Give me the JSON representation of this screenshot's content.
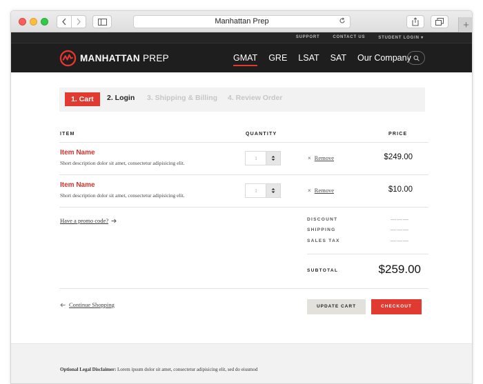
{
  "browser": {
    "url_title": "Manhattan Prep",
    "new_tab_glyph": "+"
  },
  "topbar": {
    "links": [
      "SUPPORT",
      "CONTACT US",
      "STUDENT LOGIN ▾"
    ]
  },
  "header": {
    "logo_bold": "MANHATTAN",
    "logo_light": "PREP",
    "nav": [
      "GMAT",
      "GRE",
      "LSAT",
      "SAT",
      "Our Company"
    ],
    "active_nav": "GMAT"
  },
  "steps": [
    "1. Cart",
    "2. Login",
    "3. Shipping & Billing",
    "4. Review Order"
  ],
  "table": {
    "headers": {
      "item": "ITEM",
      "quantity": "QUANTITY",
      "price": "PRICE"
    },
    "rows": [
      {
        "name": "Item Name",
        "description": "Short description dolor sit amet, consectetur adipisicing elit.",
        "quantity": "1",
        "remove": "Remove",
        "price": "$249.00"
      },
      {
        "name": "Item Name",
        "description": "Short description dolor sit amet, consectetur adipisicing elit.",
        "quantity": "1",
        "remove": "Remove",
        "price": "$10.00"
      }
    ]
  },
  "summary": {
    "promo": "Have a promo code?",
    "discount_label": "DISCOUNT",
    "discount_value": "———",
    "shipping_label": "SHIPPING",
    "shipping_value": "———",
    "tax_label": "SALES TAX",
    "tax_value": "———",
    "subtotal_label": "SUBTOTAL",
    "subtotal_value": "$259.00"
  },
  "actions": {
    "continue": "Continue Shopping",
    "update": "UPDATE CART",
    "checkout": "CHECKOUT"
  },
  "footer": {
    "disclaimer_label": "Optional Legal Disclaimer:",
    "disclaimer_text": " Lorem ipsum dolor sit amet, consectetur adipisicing elit, sed do eiusmod"
  },
  "colors": {
    "brand_red": "#e03a31",
    "header_bg": "#1e1e1e"
  }
}
